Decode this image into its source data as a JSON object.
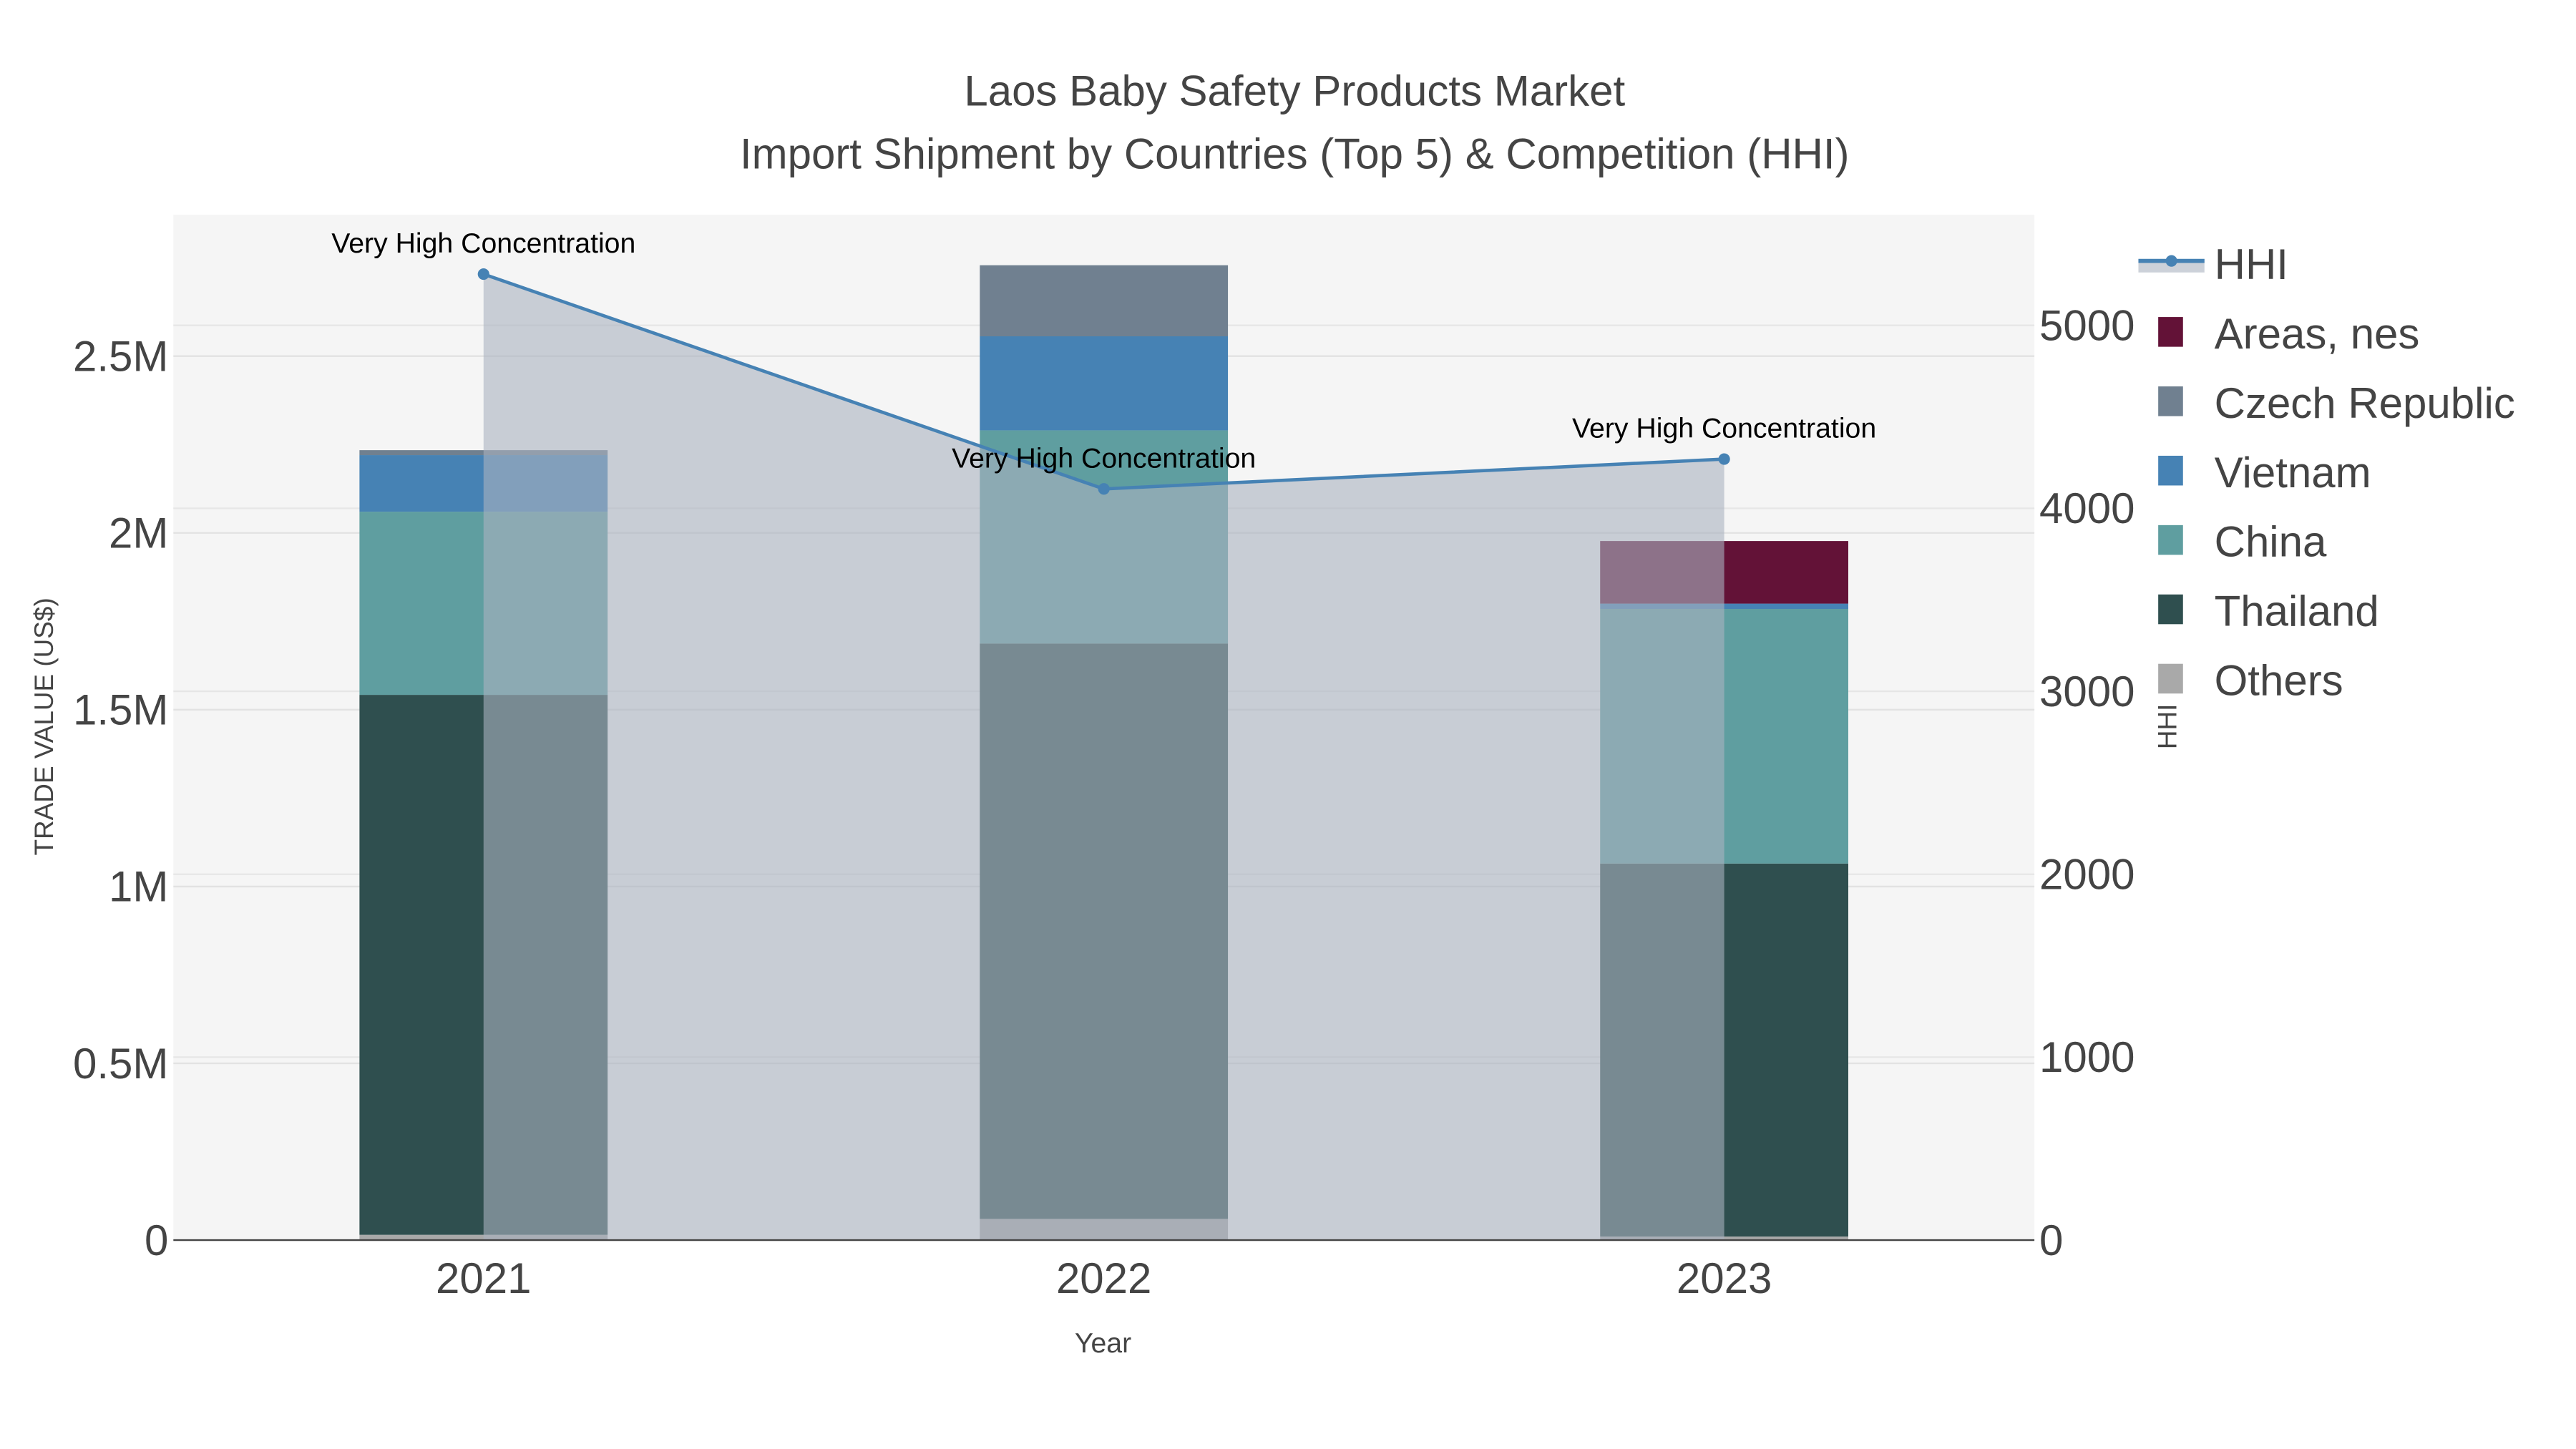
{
  "chart_data": {
    "type": "bar",
    "barmode": "stack",
    "title": "Laos Baby Safety Products Market",
    "subtitle": "Import Shipment by Countries (Top 5) & Competition (HHI)",
    "xlabel": "Year",
    "ylabel": "TRADE VALUE (US$)",
    "y2label": "HHI",
    "categories": [
      "2021",
      "2022",
      "2023"
    ],
    "ylim": [
      0,
      2900000
    ],
    "yticks": [
      0,
      500000,
      1000000,
      1500000,
      2000000,
      2500000
    ],
    "ytick_labels": [
      "0",
      "0.5M",
      "1M",
      "1.5M",
      "2M",
      "2.5M"
    ],
    "y2lim": [
      0,
      5605
    ],
    "y2ticks": [
      0,
      1000,
      2000,
      3000,
      4000,
      5000
    ],
    "y2tick_labels": [
      "0",
      "1000",
      "2000",
      "3000",
      "4000",
      "5000"
    ],
    "grid": true,
    "legend_placement": "right",
    "plot_bgcolor": "#F5F5F5",
    "series": [
      {
        "name": "Others",
        "color": "#A9A9A9",
        "values": [
          15000,
          60000,
          10000
        ]
      },
      {
        "name": "Thailand",
        "color": "#2F4F4F",
        "values": [
          1527000,
          1627000,
          1055000
        ]
      },
      {
        "name": "China",
        "color": "#5F9EA0",
        "values": [
          518000,
          603000,
          720000
        ]
      },
      {
        "name": "Vietnam",
        "color": "#4682B4",
        "values": [
          160000,
          266000,
          15000
        ]
      },
      {
        "name": "Czech Republic",
        "color": "#708090",
        "values": [
          14000,
          201000,
          0
        ]
      },
      {
        "name": "Areas, nes",
        "color": "#631237",
        "values": [
          0,
          0,
          177000
        ]
      }
    ],
    "line": {
      "name": "HHI",
      "axis": "right",
      "color": "#4682B4",
      "fill": "tozeroy",
      "fill_color": "rgba(170,178,192,0.6)",
      "values": [
        5280,
        4106,
        4269
      ]
    },
    "annotations": [
      "Very High Concentration",
      "Very High Concentration",
      "Very High Concentration"
    ]
  }
}
